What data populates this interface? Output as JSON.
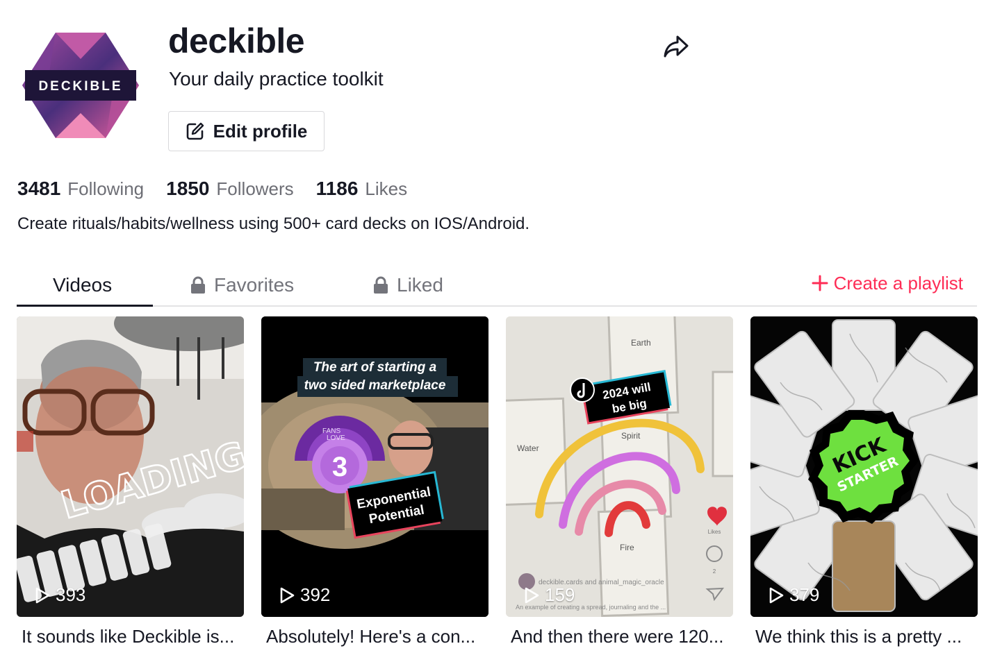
{
  "profile": {
    "avatar_text": "DECKIBLE",
    "username": "deckible",
    "nickname": "Your daily practice toolkit",
    "edit_label": "Edit profile",
    "bio": "Create rituals/habits/wellness using 500+ card decks on IOS/Android."
  },
  "stats": [
    {
      "value": "3481",
      "label": "Following"
    },
    {
      "value": "1850",
      "label": "Followers"
    },
    {
      "value": "1186",
      "label": "Likes"
    }
  ],
  "tabs": [
    {
      "label": "Videos",
      "locked": false,
      "active": true
    },
    {
      "label": "Favorites",
      "locked": true,
      "active": false
    },
    {
      "label": "Liked",
      "locked": true,
      "active": false
    }
  ],
  "playlist_label": "Create a playlist",
  "videos": [
    {
      "views": "393",
      "caption": "It sounds like Deckible is...",
      "overlay": "LOADING"
    },
    {
      "views": "392",
      "caption": "Absolutely! Here's a con...",
      "overlay_title_1": "The art of starting a",
      "overlay_title_2": "two sided marketplace",
      "sticker_1": "Exponential",
      "sticker_2": "Potential",
      "badge_num": "3",
      "badge_text_1": "FANS",
      "badge_text_2": "LOVE"
    },
    {
      "views": "159",
      "caption": "And then there were 120...",
      "sticker_1": "2024 will",
      "sticker_2": "be big",
      "card_earth": "Earth",
      "card_spirit": "Spirit",
      "card_water": "Water",
      "card_fire": "Fire",
      "likes_label": "Likes",
      "comments_count": "2",
      "account_line": "deckible.cards and animal_magic_oracle",
      "desc_line": "An example of creating a spread, journaling and the ..."
    },
    {
      "views": "379",
      "caption": "We think this is a pretty ...",
      "badge_1": "KICK",
      "badge_2": "STARTER"
    }
  ],
  "colors": {
    "accent": "#fe2c55",
    "text": "#161823",
    "muted": "#73747b"
  }
}
